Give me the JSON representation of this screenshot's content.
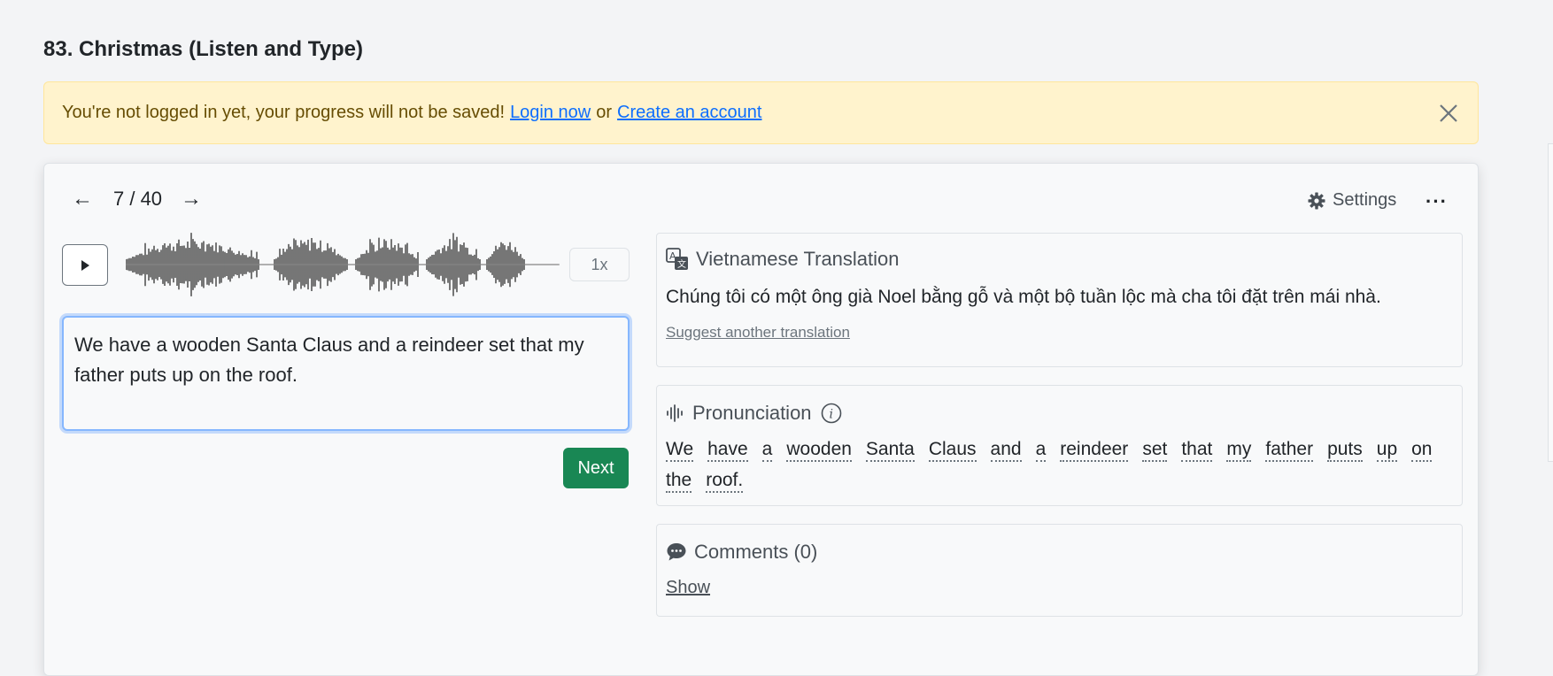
{
  "page": {
    "title": "83. Christmas (Listen and Type)"
  },
  "alert": {
    "message": "You're not logged in yet, your progress will not be saved!",
    "login_link": "Login now",
    "or_text": "or",
    "create_link": "Create an account",
    "link_color": "#0d6efd"
  },
  "nav": {
    "prev_icon": "←",
    "counter": "7 / 40",
    "next_icon": "→",
    "settings_label": "Settings",
    "more_icon": "···"
  },
  "player": {
    "play_icon": "play-icon",
    "speed": "1x"
  },
  "answer": {
    "value": "We have a wooden Santa Claus and a reindeer set that my father puts up on the roof."
  },
  "next_button": {
    "label": "Next",
    "color": "#198754"
  },
  "translation": {
    "title": "Vietnamese Translation",
    "text": "Chúng tôi có một ông già Noel bằng gỗ và một bộ tuần lộc mà cha tôi đặt trên mái nhà.",
    "suggest_link": "Suggest another translation"
  },
  "pronunciation": {
    "title": "Pronunciation",
    "words": [
      "We",
      "have",
      "a",
      "wooden",
      "Santa",
      "Claus",
      "and",
      "a",
      "reindeer",
      "set",
      "that",
      "my",
      "father",
      "puts",
      "up",
      "on",
      "the",
      "roof."
    ]
  },
  "comments": {
    "title": "Comments (0)",
    "show_link": "Show"
  }
}
